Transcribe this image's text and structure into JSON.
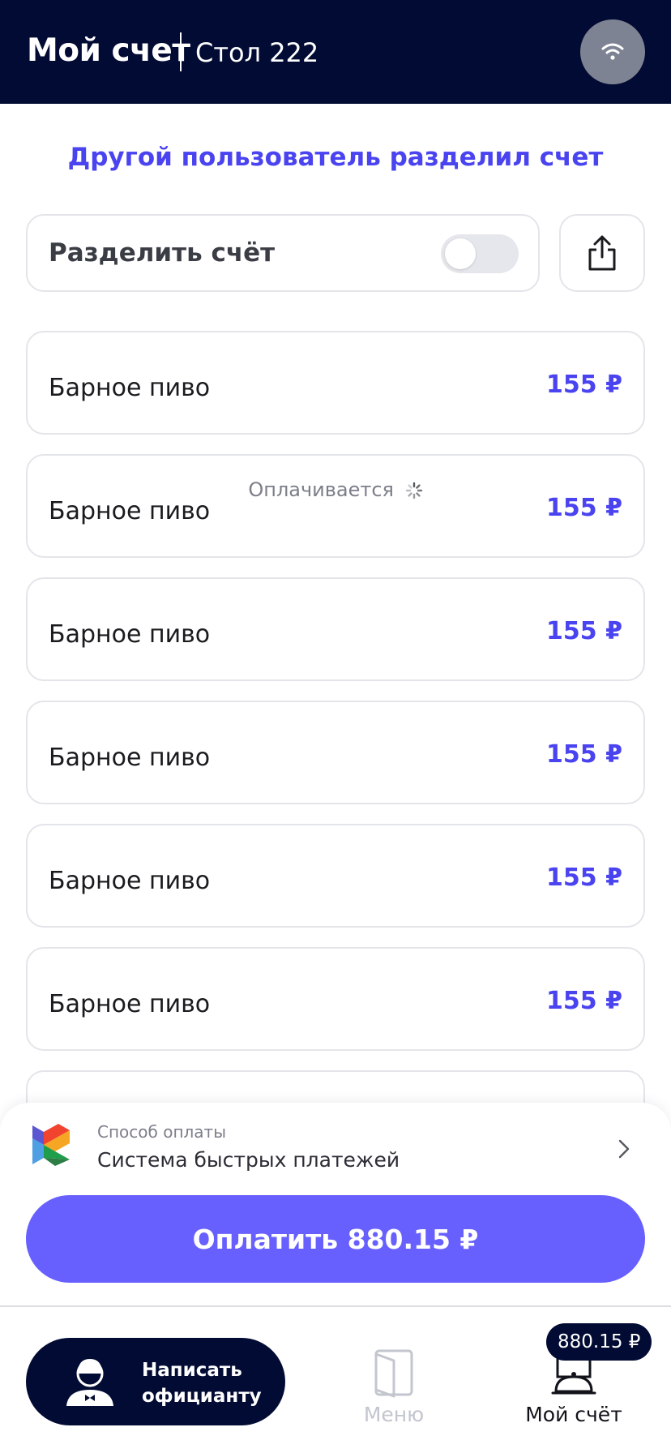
{
  "header": {
    "title": "Мой счет",
    "table": "Стол 222",
    "wifi_icon": "wifi-icon"
  },
  "notice": "Другой пользователь разделил счет",
  "split": {
    "label": "Разделить счёт",
    "enabled": false,
    "share_icon": "share-icon"
  },
  "items": [
    {
      "name": "Барное пиво",
      "price": "155 ₽",
      "status": ""
    },
    {
      "name": "Барное пиво",
      "price": "155 ₽",
      "status": "Оплачивается"
    },
    {
      "name": "Барное пиво",
      "price": "155 ₽",
      "status": ""
    },
    {
      "name": "Барное пиво",
      "price": "155 ₽",
      "status": ""
    },
    {
      "name": "Барное пиво",
      "price": "155 ₽",
      "status": ""
    },
    {
      "name": "Барное пиво",
      "price": "155 ₽",
      "status": ""
    }
  ],
  "payment": {
    "method_label": "Способ оплаты",
    "method_value": "Система быстрых платежей",
    "pay_button": "Оплатить 880.15 ₽"
  },
  "bottom_nav": {
    "waiter_label": "Написать официанту",
    "menu_label": "Меню",
    "bill_label": "Мой счёт",
    "bill_badge": "880.15 ₽"
  },
  "colors": {
    "header_bg": "#020b33",
    "accent": "#4a43f0",
    "pay_button": "#6760ff"
  }
}
